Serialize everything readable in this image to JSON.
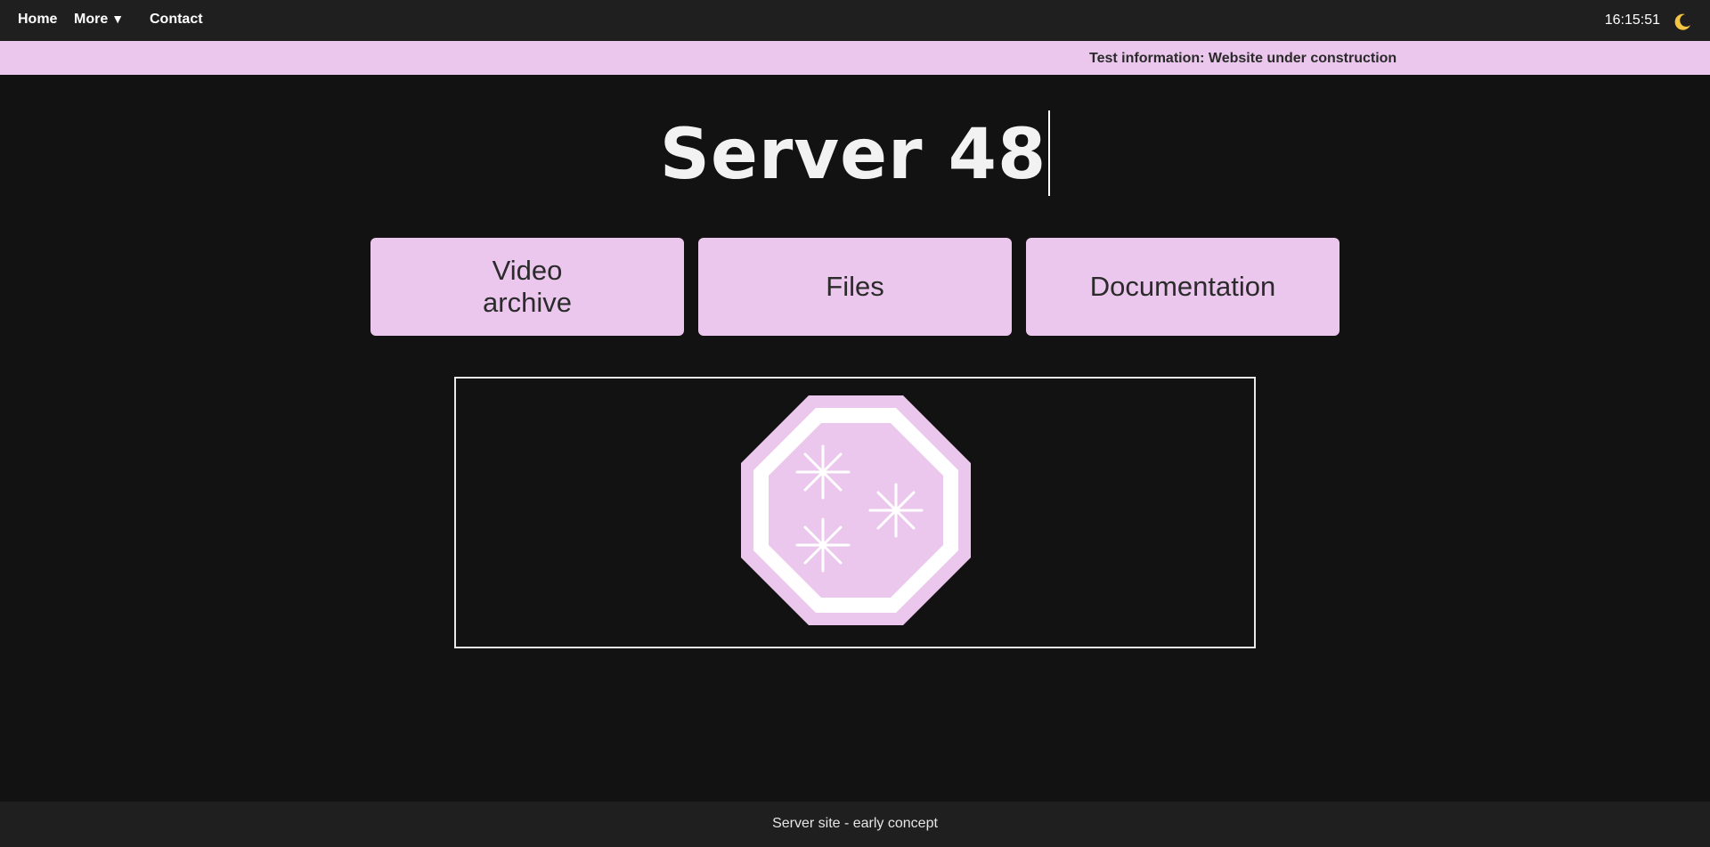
{
  "nav": {
    "home": "Home",
    "more": "More",
    "more_caret": "▼",
    "contact": "Contact",
    "clock": "16:15:51",
    "theme_icon": "moon-icon"
  },
  "banner": {
    "text": "Test information: Website under construction"
  },
  "title": "Server 48",
  "tiles": [
    {
      "label": "Video archive"
    },
    {
      "label": "Files"
    },
    {
      "label": "Documentation"
    }
  ],
  "logo": {
    "icon": "octagon-sparkle-logo",
    "fill": "#ebc7ed",
    "accent": "#ffffff"
  },
  "footer": {
    "text": "Server site - early concept"
  },
  "colors": {
    "background": "#121212",
    "navbar": "#1f1f1f",
    "accent": "#ebc7ed"
  }
}
